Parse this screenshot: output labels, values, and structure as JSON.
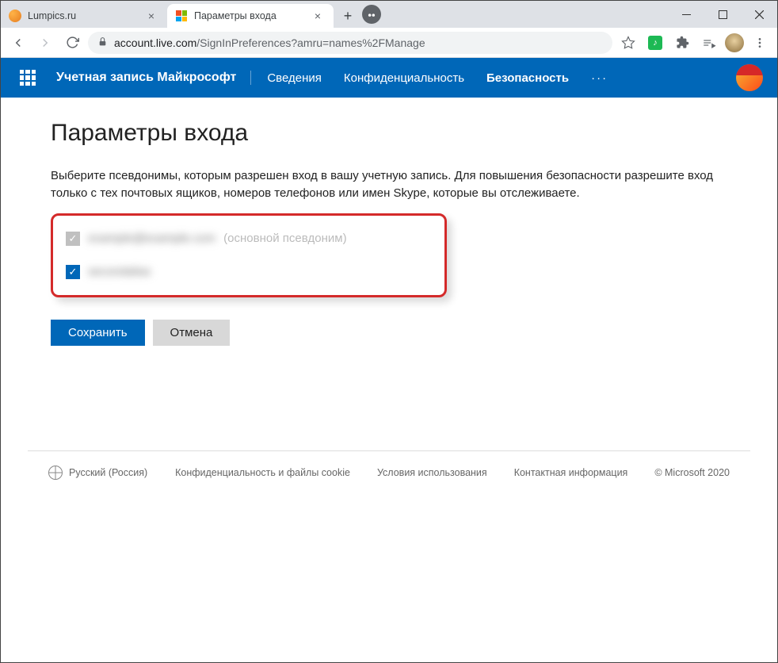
{
  "browser": {
    "tabs": [
      {
        "title": "Lumpics.ru"
      },
      {
        "title": "Параметры входа"
      }
    ],
    "url_host": "account.live.com",
    "url_path": "/SignInPreferences?amru=names%2FManage"
  },
  "ms_header": {
    "brand": "Учетная запись Майкрософт",
    "nav": {
      "info": "Сведения",
      "privacy": "Конфиденциальность",
      "security": "Безопасность"
    }
  },
  "page": {
    "title": "Параметры входа",
    "description": "Выберите псевдонимы, которым разрешен вход в вашу учетную запись. Для повышения безопасности разрешите вход только с тех почтовых ящиков, номеров телефонов или имен Skype, которые вы отслеживаете.",
    "aliases": [
      {
        "name_masked": "example@example.com",
        "suffix": "(основной псевдоним)",
        "checked": true,
        "disabled": true
      },
      {
        "name_masked": "secondalias",
        "suffix": "",
        "checked": true,
        "disabled": false
      }
    ],
    "save": "Сохранить",
    "cancel": "Отмена"
  },
  "footer": {
    "lang": "Русский (Россия)",
    "privacy": "Конфиденциальность и файлы cookie",
    "terms": "Условия использования",
    "contact": "Контактная информация",
    "copyright": "© Microsoft 2020"
  }
}
